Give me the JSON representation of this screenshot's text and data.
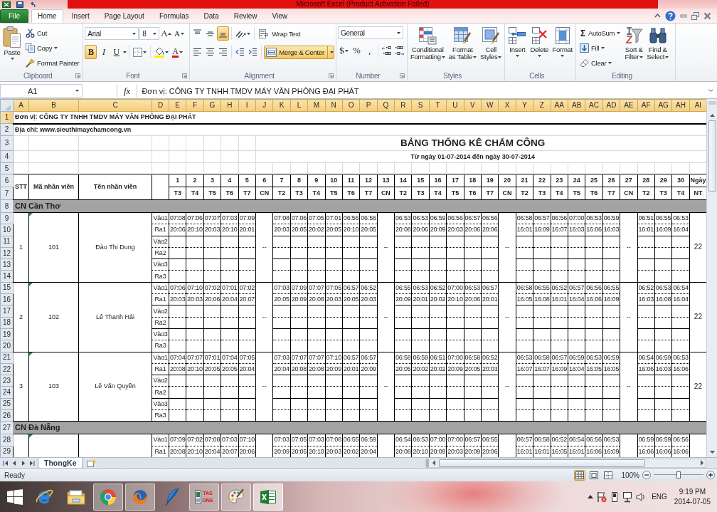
{
  "window": {
    "title": "Microsoft Excel (Product Activation Failed)"
  },
  "ribbon_tabs": [
    {
      "label": "File",
      "kind": "file",
      "selected": false
    },
    {
      "label": "Home",
      "kind": "tab",
      "selected": true
    },
    {
      "label": "Insert",
      "kind": "tab",
      "selected": false
    },
    {
      "label": "Page Layout",
      "kind": "tab",
      "selected": false
    },
    {
      "label": "Formulas",
      "kind": "tab",
      "selected": false
    },
    {
      "label": "Data",
      "kind": "tab",
      "selected": false
    },
    {
      "label": "Review",
      "kind": "tab",
      "selected": false
    },
    {
      "label": "View",
      "kind": "tab",
      "selected": false
    }
  ],
  "ribbon": {
    "clipboard": {
      "paste": "Paste",
      "cut": "Cut",
      "copy": "Copy",
      "format_painter": "Format Painter",
      "label": "Clipboard"
    },
    "font": {
      "name": "Arial",
      "size": "8",
      "grow": "A",
      "shrink": "A",
      "bold": {
        "label": "B",
        "on": true
      },
      "italic": {
        "label": "I",
        "on": false
      },
      "underline": {
        "label": "U",
        "on": false
      },
      "font_color": "A",
      "label": "Font"
    },
    "alignment": {
      "vertical": [
        {
          "kind": "top",
          "selected": false
        },
        {
          "kind": "middle",
          "selected": false
        },
        {
          "kind": "bottom",
          "selected": true
        }
      ],
      "horizontal": [
        {
          "kind": "left",
          "selected": false
        },
        {
          "kind": "center",
          "selected": false
        },
        {
          "kind": "right",
          "selected": false
        }
      ],
      "wrap_text": {
        "label": "Wrap Text",
        "on": false
      },
      "merge_center": {
        "label": "Merge & Center",
        "on": true
      },
      "label": "Alignment"
    },
    "number": {
      "format": "General",
      "currency": "$",
      "percent": "%",
      "comma": ",",
      "label": "Number"
    },
    "styles": {
      "buttons": [
        {
          "kind": "conditional",
          "lines": [
            "Conditional",
            "Formatting"
          ]
        },
        {
          "kind": "table",
          "lines": [
            "Format",
            "as Table"
          ]
        },
        {
          "kind": "cell",
          "lines": [
            "Cell",
            "Styles"
          ]
        }
      ],
      "label": "Styles"
    },
    "cells": {
      "buttons": [
        {
          "kind": "insert",
          "label": "Insert"
        },
        {
          "kind": "delete",
          "label": "Delete"
        },
        {
          "kind": "format",
          "label": "Format"
        }
      ],
      "label": "Cells"
    },
    "editing": {
      "sum_symbol": "Σ",
      "autosum": "AutoSum",
      "fill": "Fill",
      "clear": "Clear",
      "buttons": [
        {
          "kind": "sort",
          "lines": [
            "Sort &",
            "Filter"
          ]
        },
        {
          "kind": "find",
          "lines": [
            "Find &",
            "Select"
          ]
        }
      ],
      "label": "Editing"
    }
  },
  "formula_bar": {
    "cell": "A1",
    "function_label": "fx",
    "content": "Đơn vị: CÔNG TY TNHH TMDV MÁY VĂN PHÒNG ĐẠI PHÁT"
  },
  "sheet": {
    "columns": [
      {
        "label": "A",
        "selected": true
      },
      {
        "label": "B",
        "selected": true
      },
      {
        "label": "C",
        "selected": true
      },
      {
        "label": "D",
        "selected": true
      },
      {
        "label": "E",
        "selected": true
      },
      {
        "label": "F",
        "selected": true
      },
      {
        "label": "G",
        "selected": true
      },
      {
        "label": "H",
        "selected": true
      },
      {
        "label": "I",
        "selected": true
      },
      {
        "label": "J",
        "selected": true
      },
      {
        "label": "K",
        "selected": true
      },
      {
        "label": "L",
        "selected": true
      },
      {
        "label": "M",
        "selected": true
      },
      {
        "label": "N",
        "selected": true
      },
      {
        "label": "O",
        "selected": true
      },
      {
        "label": "P",
        "selected": true
      },
      {
        "label": "Q",
        "selected": true
      },
      {
        "label": "R",
        "selected": true
      },
      {
        "label": "S",
        "selected": true
      },
      {
        "label": "T",
        "selected": true
      },
      {
        "label": "U",
        "selected": true
      },
      {
        "label": "V",
        "selected": true
      },
      {
        "label": "W",
        "selected": true
      },
      {
        "label": "X",
        "selected": true
      },
      {
        "label": "Y",
        "selected": true
      },
      {
        "label": "Z",
        "selected": true
      },
      {
        "label": "AA",
        "selected": true
      },
      {
        "label": "AB",
        "selected": true
      },
      {
        "label": "AC",
        "selected": true
      },
      {
        "label": "AD",
        "selected": true
      },
      {
        "label": "AE",
        "selected": true
      },
      {
        "label": "AF",
        "selected": true
      },
      {
        "label": "AG",
        "selected": true
      },
      {
        "label": "AH",
        "selected": true
      },
      {
        "label": "AI",
        "selected": true
      }
    ],
    "row_numbers": [
      {
        "label": "1",
        "selected": true
      },
      {
        "label": "2",
        "selected": false
      },
      {
        "label": "3",
        "selected": false
      },
      {
        "label": "4",
        "selected": false
      },
      {
        "label": "5",
        "selected": false
      },
      {
        "label": "6",
        "selected": false
      },
      {
        "label": "7",
        "selected": false
      },
      {
        "label": "8",
        "selected": false
      },
      {
        "label": "9",
        "selected": false
      },
      {
        "label": "10",
        "selected": false
      },
      {
        "label": "11",
        "selected": false
      },
      {
        "label": "12",
        "selected": false
      },
      {
        "label": "13",
        "selected": false
      },
      {
        "label": "14",
        "selected": false
      },
      {
        "label": "15",
        "selected": false
      },
      {
        "label": "16",
        "selected": false
      },
      {
        "label": "17",
        "selected": false
      },
      {
        "label": "18",
        "selected": false
      },
      {
        "label": "19",
        "selected": false
      },
      {
        "label": "20",
        "selected": false
      },
      {
        "label": "21",
        "selected": false
      },
      {
        "label": "22",
        "selected": false
      },
      {
        "label": "23",
        "selected": false
      },
      {
        "label": "24",
        "selected": false
      },
      {
        "label": "25",
        "selected": false
      },
      {
        "label": "26",
        "selected": false
      },
      {
        "label": "27",
        "selected": false
      },
      {
        "label": "28",
        "selected": false
      },
      {
        "label": "29",
        "selected": false
      }
    ],
    "title_block": {
      "company": "Đơn vị: CÔNG TY TNHH TMDV MÁY VĂN PHÒNG ĐẠI PHÁT",
      "address": "Địa chỉ: www.sieuthimaychamcong.vn",
      "title": "BẢNG THỐNG KÊ CHẤM CÔNG",
      "period": "Từ ngày 01-07-2014 đến ngày 30-07-2014"
    },
    "header": {
      "stt": "STT",
      "code": "Mã nhân viên",
      "name": "Tên nhân viên",
      "days": [
        {
          "day": "1",
          "weekday": "T3",
          "kind": "workday"
        },
        {
          "day": "2",
          "weekday": "T4",
          "kind": "workday"
        },
        {
          "day": "3",
          "weekday": "T5",
          "kind": "workday"
        },
        {
          "day": "4",
          "weekday": "T6",
          "kind": "workday"
        },
        {
          "day": "5",
          "weekday": "T7",
          "kind": "workday"
        },
        {
          "day": "6",
          "weekday": "CN",
          "kind": "sunday"
        },
        {
          "day": "7",
          "weekday": "T2",
          "kind": "workday"
        },
        {
          "day": "8",
          "weekday": "T3",
          "kind": "workday"
        },
        {
          "day": "9",
          "weekday": "T4",
          "kind": "workday"
        },
        {
          "day": "10",
          "weekday": "T5",
          "kind": "workday"
        },
        {
          "day": "11",
          "weekday": "T6",
          "kind": "workday"
        },
        {
          "day": "12",
          "weekday": "T7",
          "kind": "workday"
        },
        {
          "day": "13",
          "weekday": "CN",
          "kind": "sunday"
        },
        {
          "day": "14",
          "weekday": "T2",
          "kind": "workday"
        },
        {
          "day": "15",
          "weekday": "T3",
          "kind": "workday"
        },
        {
          "day": "16",
          "weekday": "T4",
          "kind": "workday"
        },
        {
          "day": "17",
          "weekday": "T5",
          "kind": "workday"
        },
        {
          "day": "18",
          "weekday": "T6",
          "kind": "workday"
        },
        {
          "day": "19",
          "weekday": "T7",
          "kind": "workday"
        },
        {
          "day": "20",
          "weekday": "CN",
          "kind": "sunday"
        },
        {
          "day": "21",
          "weekday": "T2",
          "kind": "workday"
        },
        {
          "day": "22",
          "weekday": "T3",
          "kind": "workday"
        },
        {
          "day": "23",
          "weekday": "T4",
          "kind": "workday"
        },
        {
          "day": "24",
          "weekday": "T5",
          "kind": "workday"
        },
        {
          "day": "25",
          "weekday": "T6",
          "kind": "workday"
        },
        {
          "day": "26",
          "weekday": "T7",
          "kind": "workday"
        },
        {
          "day": "27",
          "weekday": "CN",
          "kind": "sunday"
        },
        {
          "day": "28",
          "weekday": "T2",
          "kind": "workday"
        },
        {
          "day": "29",
          "weekday": "T3",
          "kind": "workday"
        },
        {
          "day": "30",
          "weekday": "T4",
          "kind": "workday"
        }
      ],
      "total": "Ngày",
      "total_sub": "NT"
    },
    "branches": [
      {
        "name": "CN Cần Thơ",
        "employees": [
          {
            "stt": "1",
            "code": "101",
            "flagged": true,
            "name": "Đào Thi Dung",
            "off_mark": "--",
            "total": "22",
            "punches": [
              {
                "label": "Vào1",
                "times": [
                  "07:08",
                  "07:06",
                  "07:07",
                  "07:03",
                  "07:09",
                  "07:08",
                  "07:06",
                  "07:05",
                  "07:01",
                  "06:56",
                  "06:56",
                  "06:53",
                  "06:53",
                  "06:59",
                  "06:56",
                  "06:57",
                  "06:56",
                  "06:58",
                  "06:57",
                  "06:56",
                  "07:00",
                  "06:53",
                  "06:59",
                  "06:51",
                  "06:55",
                  "06:53"
                ]
              },
              {
                "label": "Ra1",
                "times": [
                  "20:06",
                  "20:10",
                  "20:03",
                  "20:10",
                  "20:01",
                  "20:03",
                  "20:05",
                  "20:02",
                  "20:05",
                  "20:10",
                  "20:05",
                  "20:08",
                  "20:06",
                  "20:09",
                  "20:03",
                  "20:06",
                  "20:06",
                  "16:01",
                  "16:09",
                  "16:07",
                  "16:03",
                  "16:06",
                  "16:03",
                  "16:01",
                  "16:09",
                  "16:04"
                ]
              },
              {
                "label": "Vào2"
              },
              {
                "label": "Ra2"
              },
              {
                "label": "Vào3"
              },
              {
                "label": "Ra3"
              }
            ]
          },
          {
            "stt": "2",
            "code": "102",
            "flagged": true,
            "name": "Lê Thanh Hải",
            "off_mark": "--",
            "total": "22",
            "punches": [
              {
                "label": "Vào1",
                "times": [
                  "07:06",
                  "07:10",
                  "07:02",
                  "07:01",
                  "07:02",
                  "07:03",
                  "07:09",
                  "07:07",
                  "07:05",
                  "06:57",
                  "06:52",
                  "06:55",
                  "06:53",
                  "06:52",
                  "07:00",
                  "06:53",
                  "06:57",
                  "06:58",
                  "06:55",
                  "06:52",
                  "06:57",
                  "06:56",
                  "06:55",
                  "06:52",
                  "06:53",
                  "06:54"
                ]
              },
              {
                "label": "Ra1",
                "times": [
                  "20:03",
                  "20:03",
                  "20:06",
                  "20:04",
                  "20:07",
                  "20:05",
                  "20:09",
                  "20:08",
                  "20:03",
                  "20:05",
                  "20:03",
                  "20:09",
                  "20:01",
                  "20:02",
                  "20:10",
                  "20:06",
                  "20:01",
                  "16:05",
                  "16:08",
                  "16:01",
                  "16:04",
                  "16:06",
                  "16:09",
                  "16:03",
                  "16:08",
                  "16:04"
                ]
              },
              {
                "label": "Vào2"
              },
              {
                "label": "Ra2"
              },
              {
                "label": "Vào3"
              },
              {
                "label": "Ra3"
              }
            ]
          },
          {
            "stt": "3",
            "code": "103",
            "flagged": true,
            "name": "Lê Văn Quyền",
            "off_mark": "--",
            "total": "22",
            "punches": [
              {
                "label": "Vào1",
                "times": [
                  "07:04",
                  "07:07",
                  "07:01",
                  "07:04",
                  "07:05",
                  "07:03",
                  "07:07",
                  "07:07",
                  "07:10",
                  "06:57",
                  "06:57",
                  "06:58",
                  "06:59",
                  "06:51",
                  "07:00",
                  "06:58",
                  "06:52",
                  "06:53",
                  "06:58",
                  "06:57",
                  "06:59",
                  "06:53",
                  "06:59",
                  "06:54",
                  "06:59",
                  "06:53"
                ]
              },
              {
                "label": "Ra1",
                "times": [
                  "20:08",
                  "20:10",
                  "20:05",
                  "20:05",
                  "20:04",
                  "20:04",
                  "20:08",
                  "20:08",
                  "20:09",
                  "20:01",
                  "20:09",
                  "20:05",
                  "20:02",
                  "20:02",
                  "20:09",
                  "20:05",
                  "20:03",
                  "16:07",
                  "16:07",
                  "16:09",
                  "16:04",
                  "16:05",
                  "16:05",
                  "16:06",
                  "16:03",
                  "16:06"
                ]
              },
              {
                "label": "Vào2"
              },
              {
                "label": "Ra2"
              },
              {
                "label": "Vào3"
              },
              {
                "label": "Ra3"
              }
            ]
          }
        ]
      },
      {
        "name": "CN Đà Nẵng",
        "employees": [
          {
            "flagged": true,
            "punches": [
              {
                "label": "Vào1",
                "times": [
                  "07:09",
                  "07:02",
                  "07:08",
                  "07:03",
                  "07:10",
                  "07:03",
                  "07:05",
                  "07:03",
                  "07:08",
                  "06:55",
                  "06:59",
                  "06:54",
                  "06:53",
                  "07:00",
                  "07:00",
                  "06:57",
                  "06:55",
                  "06:57",
                  "06:58",
                  "06:52",
                  "06:54",
                  "06:56",
                  "06:53",
                  "06:59",
                  "06:59",
                  "06:56"
                ]
              },
              {
                "label": "Ra1",
                "times": [
                  "20:08",
                  "20:10",
                  "20:04",
                  "20:07",
                  "20:06",
                  "20:09",
                  "20:05",
                  "20:10",
                  "20:03",
                  "20:02",
                  "20:04",
                  "20:08",
                  "20:10",
                  "20:09",
                  "20:03",
                  "20:09",
                  "20:06",
                  "16:01",
                  "16:01",
                  "16:05",
                  "16:01",
                  "16:06",
                  "16:09",
                  "16:06",
                  "16:06",
                  "16:06"
                ]
              }
            ]
          }
        ]
      }
    ]
  },
  "sheet_tabs": [
    {
      "label": "ThongKe",
      "selected": true
    }
  ],
  "status_bar": {
    "status": "Ready",
    "views": [
      {
        "kind": "normal",
        "selected": true
      },
      {
        "kind": "page_layout",
        "selected": false
      },
      {
        "kind": "page_break",
        "selected": false
      }
    ],
    "zoom": "100%",
    "zoom_slider": {
      "level": 0.5
    }
  },
  "taskbar": {
    "apps": [
      {
        "kind": "ie",
        "running": false,
        "selected": false
      },
      {
        "kind": "explorer",
        "running": false,
        "selected": false
      },
      {
        "kind": "chrome",
        "running": true,
        "selected": false
      },
      {
        "kind": "firefox",
        "running": true,
        "selected": false
      },
      {
        "kind": "quill",
        "running": false,
        "selected": false
      },
      {
        "kind": "tas",
        "running": true,
        "selected": false,
        "lines": [
          "TAS",
          "ONE"
        ]
      },
      {
        "kind": "paint",
        "running": true,
        "selected": false
      },
      {
        "kind": "excel",
        "running": true,
        "selected": true
      }
    ],
    "language": "ENG",
    "time": "9:19 PM",
    "date": "2014-07-05"
  }
}
